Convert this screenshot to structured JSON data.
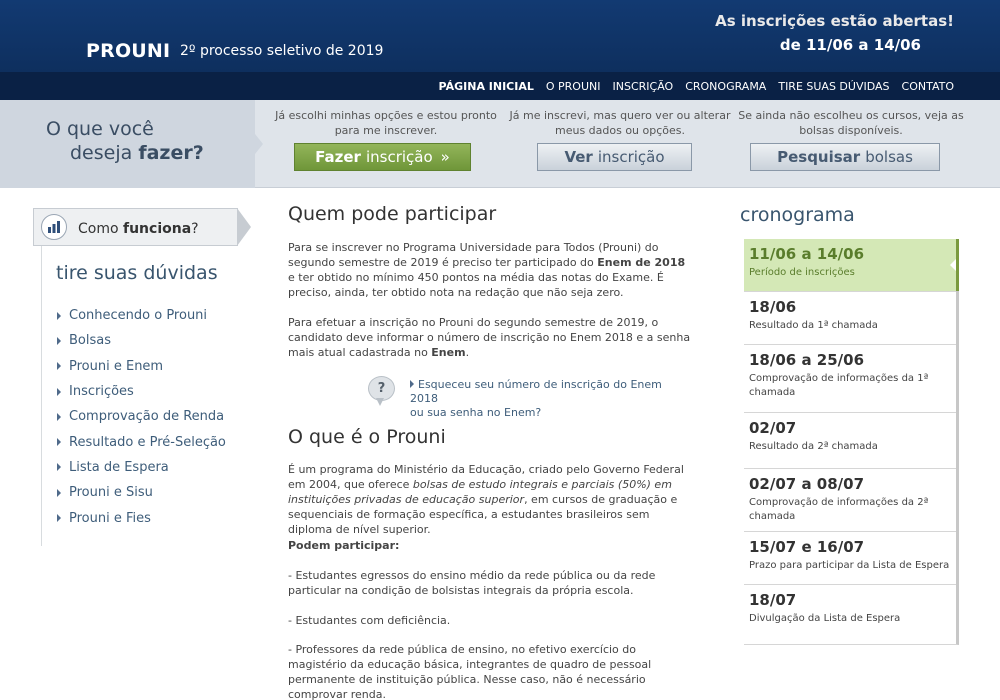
{
  "header": {
    "logo": "PROUNI",
    "subtitle": "2º processo seletivo de 2019",
    "notice_line1": "As inscrições estão abertas!",
    "notice_line2": "de 11/06 a 14/06"
  },
  "nav": {
    "items": [
      "PÁGINA INICIAL",
      "O PROUNI",
      "INSCRIÇÃO",
      "CRONOGRAMA",
      "TIRE SUAS DÚVIDAS",
      "CONTATO"
    ]
  },
  "banner": {
    "question_line1": "O que você",
    "question_line2_prefix": "deseja ",
    "question_line2_bold": "fazer?",
    "options": [
      {
        "text_line1": "Já escolhi minhas opções e estou pronto",
        "text_line2": "para me inscrever.",
        "button_bold": "Fazer",
        "button_thin": "inscrição",
        "chevron": "»"
      },
      {
        "text_line1": "Já me inscrevi, mas quero ver ou alterar",
        "text_line2": "meus dados ou opções.",
        "button_bold": "Ver",
        "button_thin": "inscrição"
      },
      {
        "text_line1": "Se ainda não escolheu os cursos, veja as",
        "text_line2": "bolsas disponíveis.",
        "button_bold": "Pesquisar",
        "button_thin": "bolsas"
      }
    ]
  },
  "sidebar": {
    "how_prefix": "Como ",
    "how_bold": "funciona",
    "how_suffix": "?",
    "title": "tire suas dúvidas",
    "items": [
      "Conhecendo o Prouni",
      "Bolsas",
      "Prouni e Enem",
      "Inscrições",
      "Comprovação de Renda",
      "Resultado e Pré-Seleção",
      "Lista de Espera",
      "Prouni e Sisu",
      "Prouni e Fies"
    ]
  },
  "main": {
    "section1_title": "Quem pode participar",
    "p1_a": "Para se inscrever no Programa Universidade para Todos (Prouni) do segundo semestre de 2019 é preciso ter participado do ",
    "p1_b": "Enem de 2018",
    "p1_c": " e ter obtido no mínimo 450 pontos na média das notas do Exame. É preciso, ainda, ter obtido nota na redação que não seja zero.",
    "p2_a": "Para efetuar a inscrição no Prouni do segundo semestre de 2019, o candidato deve informar o número de inscrição no Enem 2018 e a senha mais atual cadastrada no ",
    "p2_b": "Enem",
    "p2_c": ".",
    "faq_line1": "Esqueceu seu número de inscrição do Enem 2018",
    "faq_line2": "ou sua senha no Enem?",
    "section2_title": "O que é o Prouni",
    "p3_a": "É um programa do Ministério da Educação, criado pelo Governo Federal em 2004, que oferece ",
    "p3_b": "bolsas de estudo integrais e parciais (50%) em instituições privadas de educação superior",
    "p3_c": ", em cursos de graduação e sequenciais de formação específica, a estudantes brasileiros sem diploma de nível superior.",
    "can_title": "Podem participar:",
    "can1": "- Estudantes egressos do ensino médio da rede pública ou da rede particular na condição de bolsistas integrais da própria escola.",
    "can2": "- Estudantes com deficiência.",
    "can3": "- Professores da rede pública de ensino, no efetivo exercício do magistério da educação básica, integrantes de quadro de pessoal permanente de instituição pública. Nesse caso, não é necessário comprovar renda."
  },
  "schedule": {
    "title": "cronograma",
    "items": [
      {
        "date": "11/06 a 14/06",
        "text": "Período de inscrições",
        "active": true
      },
      {
        "date": "18/06",
        "text": "Resultado da 1ª chamada"
      },
      {
        "date": "18/06 a 25/06",
        "text": "Comprovação de informações da 1ª chamada"
      },
      {
        "date": "02/07",
        "text": "Resultado da 2ª chamada"
      },
      {
        "date": "02/07 a 08/07",
        "text": "Comprovação de informações da 2ª chamada"
      },
      {
        "date": "15/07 e 16/07",
        "text": "Prazo para participar da Lista de Espera"
      },
      {
        "date": "18/07",
        "text": "Divulgação da Lista de Espera"
      }
    ]
  },
  "colors": {
    "header_bg": "#123a72",
    "nav_bg": "#0a2145",
    "accent_green": "#6f9639",
    "schedule_active_bg": "#d4e8b6"
  }
}
